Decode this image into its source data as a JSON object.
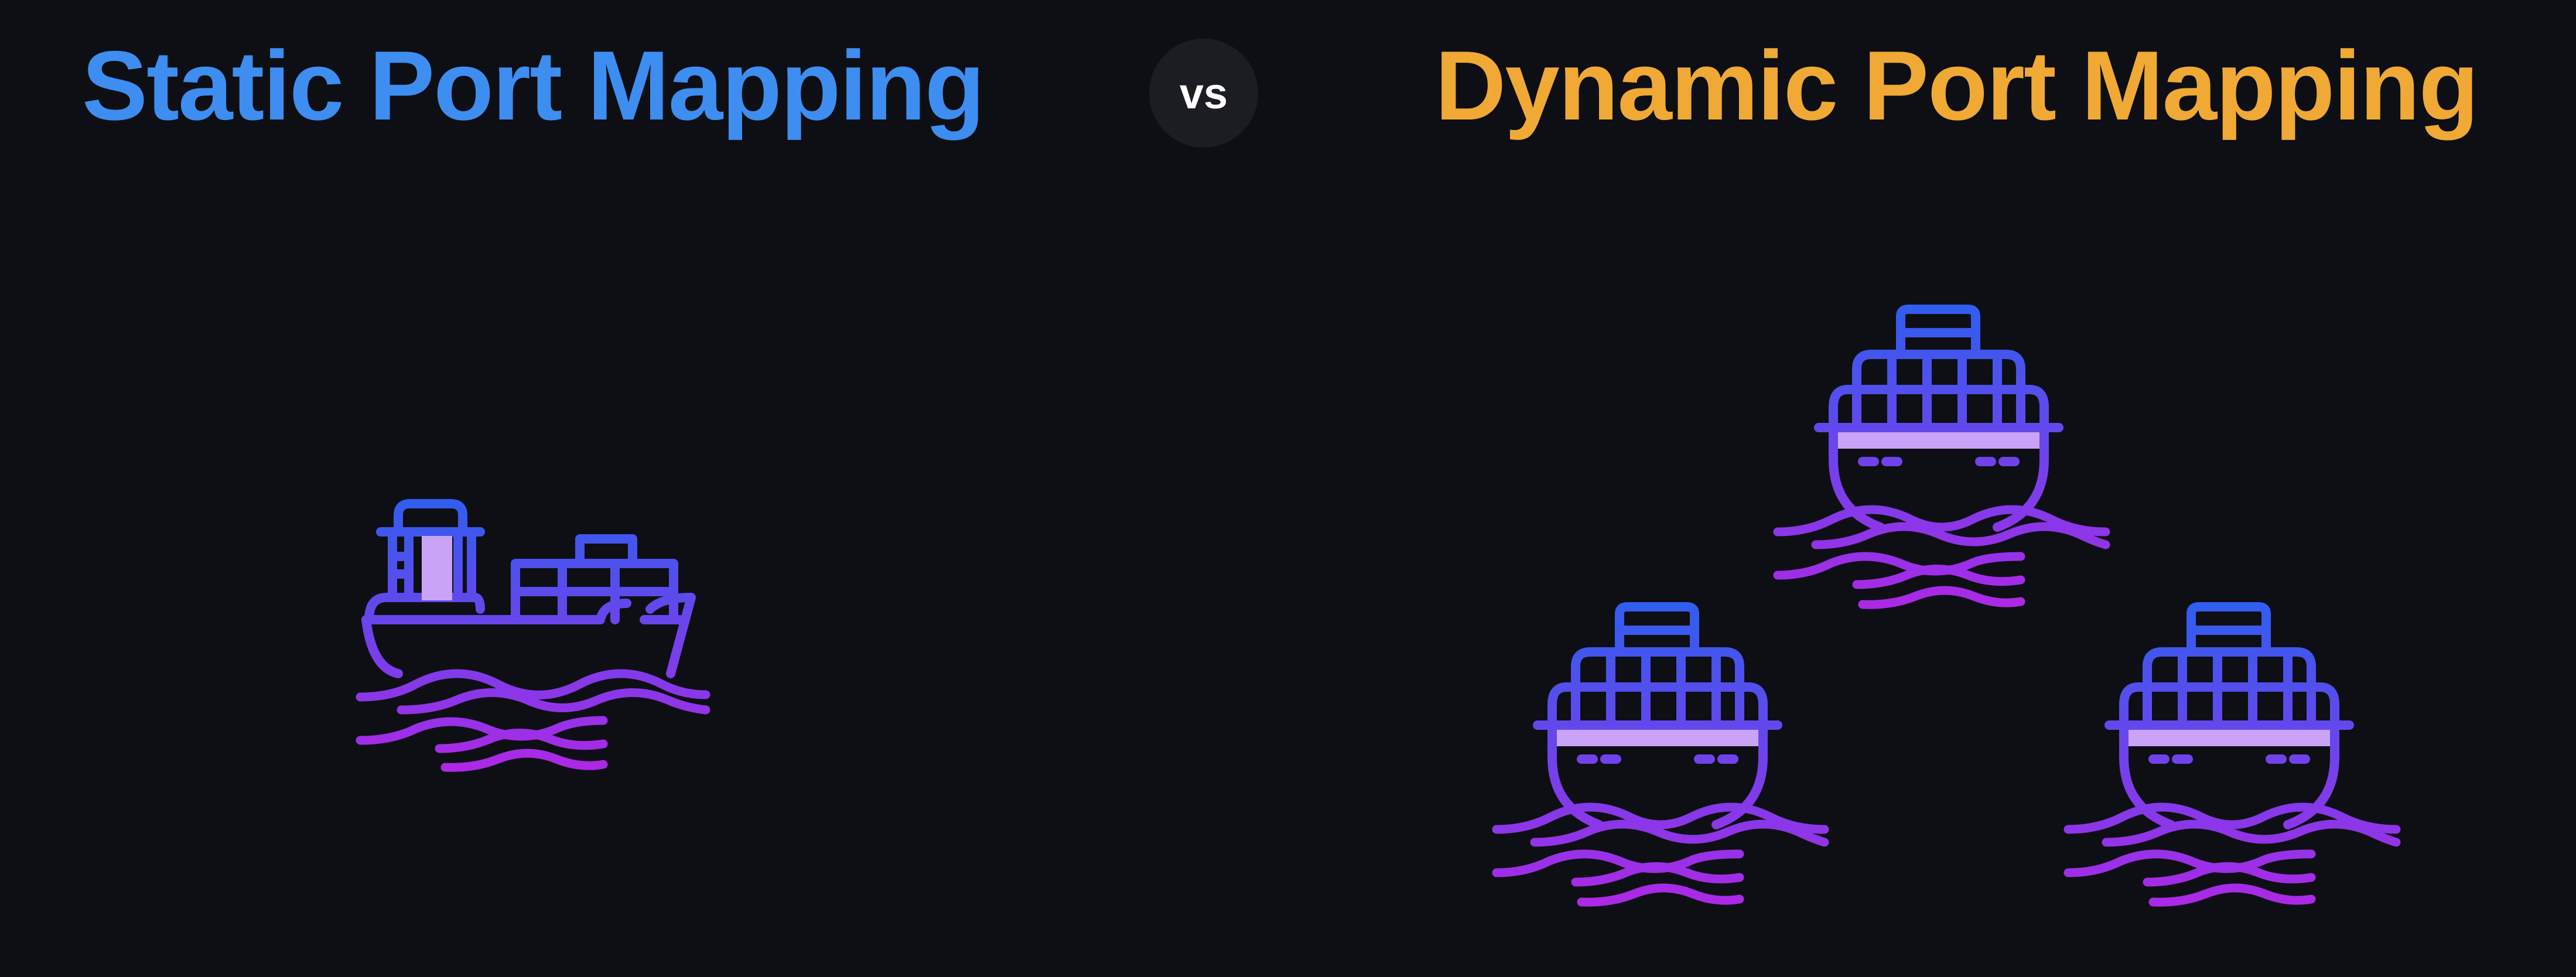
{
  "left_panel": {
    "title": "Static Port Mapping",
    "title_color": "#3d8ef0",
    "icons": [
      "cargo-ship-side-icon"
    ]
  },
  "separator": {
    "label": "vs",
    "badge_color": "#1c1d23",
    "text_color": "#ffffff"
  },
  "right_panel": {
    "title": "Dynamic Port Mapping",
    "title_color": "#f0a935",
    "icons": [
      "cargo-ship-front-icon",
      "cargo-ship-front-icon",
      "cargo-ship-front-icon"
    ]
  },
  "colors": {
    "background": "#0e0f14",
    "icon_gradient_start": "#2f5ef0",
    "icon_gradient_end": "#b027e6",
    "icon_accent": "#c9a3f5"
  }
}
